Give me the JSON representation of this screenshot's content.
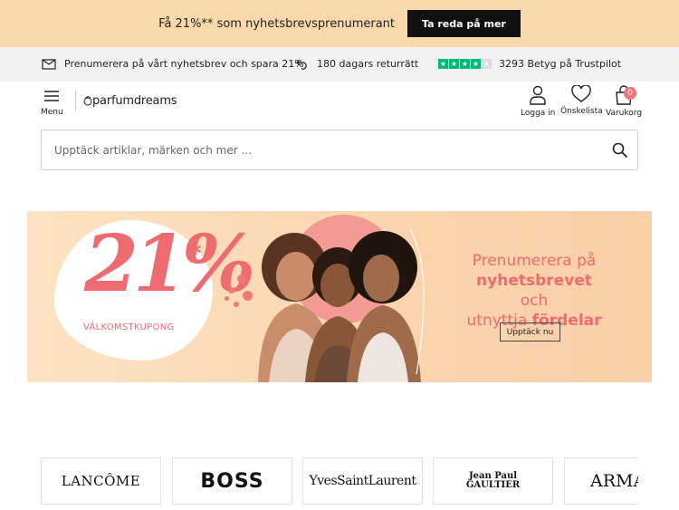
{
  "promo": {
    "text": "Få 21%** som nyhetsbrevsprenumerant",
    "button": "Ta reda på mer"
  },
  "info_bar": {
    "newsletter": "Prenumerera på vårt nyhetsbrev och spara 21%",
    "returns": "180 dagars returrätt",
    "trustpilot": "3293 Betyg på Trustpilot",
    "rating_stars": 4,
    "rating_max": 5
  },
  "header": {
    "menu_label": "Menu",
    "logo": "parfumdreams",
    "login_label": "Logga in",
    "wishlist_label": "Önskelista",
    "cart_label": "Varukorg",
    "cart_count": "0"
  },
  "search": {
    "placeholder": "Upptäck artiklar, märken och mer ..."
  },
  "banner": {
    "percent": "21%",
    "asterisk": "*",
    "coupon": "VÄLKOMSTKUPONG",
    "headline_1": "Prenumerera på",
    "headline_2": "nyhetsbrevet",
    "headline_3": "och",
    "headline_4": "utnyttja",
    "headline_5": "fördelar",
    "button": "Upptäck nu"
  },
  "brands": [
    {
      "label": "LANCÔME"
    },
    {
      "label": "BOSS"
    },
    {
      "label": "YvesSaintLaurent"
    },
    {
      "label": "Jean Paul GAULTIER"
    },
    {
      "label": "ARMANI"
    }
  ],
  "colors": {
    "promo_bg": "#f9d8ab",
    "accent": "#ee6b70",
    "trust_green": "#00b67a"
  }
}
